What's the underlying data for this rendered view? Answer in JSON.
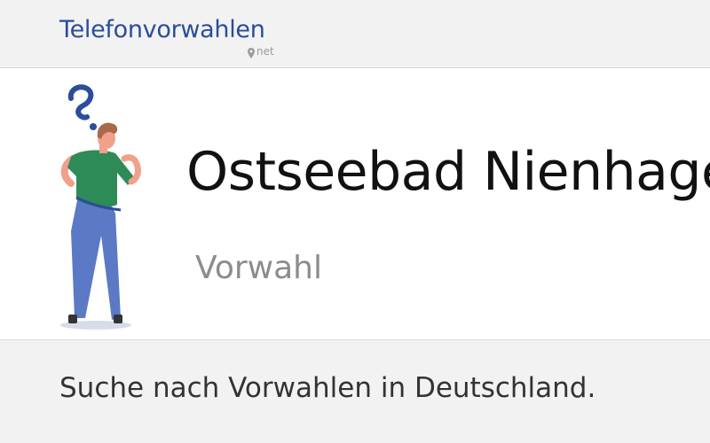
{
  "header": {
    "logo_text": "Telefonvorwahlen",
    "logo_suffix": "net",
    "logo_icon": "map-pin-icon"
  },
  "hero": {
    "title": "Ostseebad Nienhagen",
    "subtitle": "Vorwahl",
    "illustration": "thinking-person-with-question-mark"
  },
  "search": {
    "heading": "Suche nach Vorwahlen in Deutschland."
  },
  "colors": {
    "brand": "#2b4d9a",
    "shirt": "#2e8b57",
    "pants": "#5b79c4",
    "hair": "#a86a4a",
    "skin": "#f1a08a"
  }
}
